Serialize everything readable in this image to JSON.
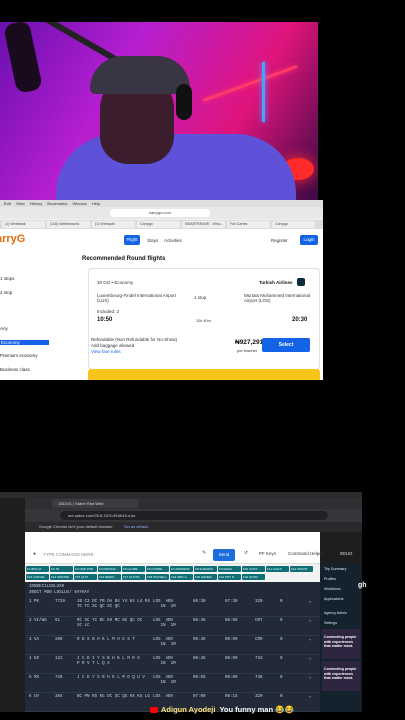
{
  "top_browser": {
    "menu": [
      "Edit",
      "View",
      "History",
      "Bookmarks",
      "Window",
      "Help"
    ],
    "url": "sarrygo.com",
    "tabs": [
      "(1) Webbank",
      "(116) Webinbound",
      "(1) Webaphi",
      "Carrygo",
      "SMARTERAVE - Wha...",
      "Full Cartes",
      "Carrygo"
    ],
    "logo": "arryG",
    "nav": {
      "flight": "Flight",
      "stays": "Stays",
      "activities": "Activities",
      "register": "Register",
      "login": "Login"
    },
    "filters": [
      "1 stops",
      "2 stop",
      "Any",
      "Economy",
      "Premium economy",
      "Business class"
    ],
    "section_title": "Recommended Round flights",
    "card": {
      "date_class": "30 Oct  •  Economy",
      "airline": "Turkish Airlines",
      "from": "Luxembourg-Findel International Airport (LUX)",
      "to": "Murtala Muhammed International Airport (LOS)",
      "stops": "1 stop",
      "included": "Included: 2",
      "depart": "10:50",
      "duration": "10h 40m",
      "arrive": "20:30",
      "refund": "Refundable (Non Refundable for No-Show)",
      "baggage": "Add baggage allowed",
      "fare_rules": "View fare rules",
      "price": "₦927,291",
      "per": "per traveler",
      "select": "Select"
    }
  },
  "bottom_browser": {
    "tab": "1BDUG | Sabre Red Web",
    "url": "sre.sabre.com/25.8.15?t=ff1bb15-s1w",
    "banner": "Google Chrome isn't your default browser",
    "banner_btn": "Set as default",
    "cmd_placeholder": "TYPE COMMAND HERE",
    "toolbar": {
      "send": "Send",
      "pf": "PF Keys",
      "helper": "Command Helper",
      "code": "9DUG"
    },
    "keys_row1": [
      "F1 BKK-M",
      "F2 JR",
      "F3 ORD PNR",
      "F4 PRICING",
      "F5 GLOBE",
      "F6 CORRE...",
      "F7 ADDRESS",
      "F8 SHARING",
      "F9 EMAIL",
      "F10 COST...",
      "F11 CHILD",
      "F12 INFANT"
    ],
    "keys_row2": [
      "F13 CANCEL",
      "F14 IGNORE",
      "F15 QUIT",
      "F16 REDIS...",
      "F17 QUOTE",
      "F18 PCCSELL",
      "F19 ABIC A...",
      "F20 GENES..",
      "F21 PRT D...",
      "F22 QCMU"
    ],
    "term_header": [
      "1DNDEC1LOSLUX¥",
      "30OCT MON LOSLUX/ ¥AY¥AY"
    ],
    "rows": [
      {
        "n": "1 PK",
        "f": "7729",
        "cls": "JB C3 DC FB OA B4 Y4 K4 L4 M4\nTC TC XC QC XC QC",
        "route": "LOS  ABV\n   1N  1M",
        "dep": "06:30",
        "arr": "07:30",
        "eq": "320",
        "d": "0"
      },
      {
        "n": "2 VI/W6",
        "f": "61",
        "cls": "RC SC YC BC KH MC NC QC OC\nXC LC",
        "route": "LOS  ABV\n   1N  1M",
        "dep": "06:45",
        "arr": "08:00",
        "eq": "CR7",
        "d": "0"
      },
      {
        "n": "3 VA",
        "f": "200",
        "cls": "R D S B H K L M H G S T",
        "route": "LOS  ABV\n   1N  1M",
        "dep": "06:45",
        "arr": "08:00",
        "eq": "CR9",
        "d": "0"
      },
      {
        "n": "4 HZ",
        "f": "121",
        "cls": "J C D I Y S B H K L M R G\nP R V T L Q S",
        "route": "LOS  ABV\n   1N  1M",
        "dep": "06:45",
        "arr": "08:00",
        "eq": "733",
        "d": "0"
      },
      {
        "n": "5 MX",
        "f": "728",
        "cls": "J C D Y S B H K L M O Q U V",
        "route": "LOS  ABV\n   1N  1M",
        "dep": "06:55",
        "arr": "08:00",
        "eq": "738",
        "d": "0"
      },
      {
        "n": "6 UV",
        "f": "384",
        "cls": "BC PN RS KG OC SC QG HX KS LG",
        "route": "LOS  ABV",
        "dep": "07:00",
        "arr": "08:15",
        "eq": "320",
        "d": "0"
      }
    ],
    "sidebar": [
      "Trip Summary",
      "Profiles",
      "Workflows",
      "Applications",
      "Agency Admin",
      "Settings"
    ],
    "ads": [
      "Connecting people with experiences that matter most."
    ]
  },
  "side_text": "gh",
  "chat": {
    "user": "Adigun Ayodeji",
    "message": "You funny man 😂😂"
  }
}
